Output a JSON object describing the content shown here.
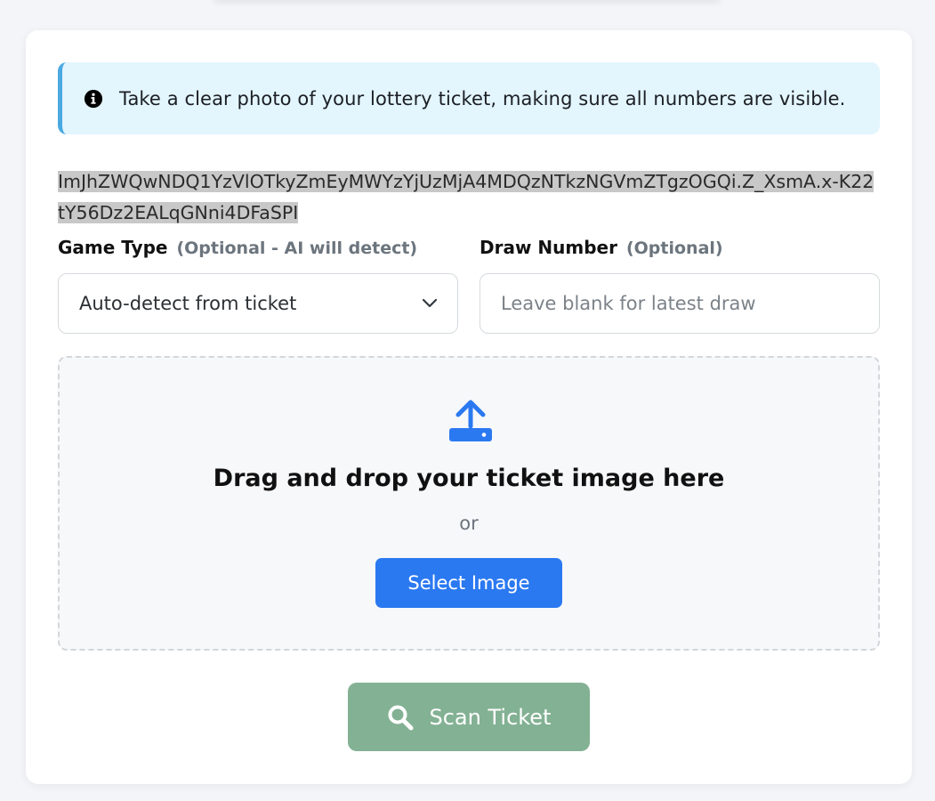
{
  "alert": {
    "icon": "info-circle-icon",
    "text": "Take a clear photo of your lottery ticket, making sure all numbers are visible."
  },
  "token_text": "ImJhZWQwNDQ1YzVlOTkyZmEyMWYzYjUzMjA4MDQzNTkzNGVmZTgzOGQi.Z_XsmA.x-K22tY56Dz2EALqGNni4DFaSPI",
  "form": {
    "game_type": {
      "label": "Game Type",
      "hint": "(Optional - AI will detect)",
      "selected": "Auto-detect from ticket",
      "icon": "chevron-down-icon"
    },
    "draw_number": {
      "label": "Draw Number",
      "hint": "(Optional)",
      "placeholder": "Leave blank for latest draw",
      "value": ""
    }
  },
  "dropzone": {
    "icon": "upload-icon",
    "title": "Drag and drop your ticket image here",
    "or": "or",
    "button_label": "Select Image"
  },
  "scan_button": {
    "icon": "search-icon",
    "label": "Scan Ticket"
  },
  "colors": {
    "primary": "#2b79f1",
    "scan_button": "#83b193",
    "alert_bg": "#e3f5fd",
    "alert_border": "#4aa9e1"
  }
}
